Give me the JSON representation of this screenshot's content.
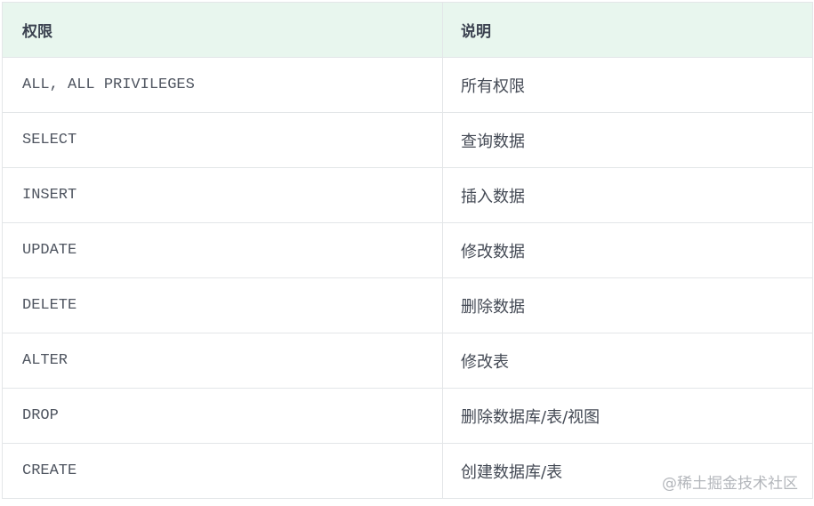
{
  "table": {
    "headers": [
      "权限",
      "说明"
    ],
    "rows": [
      {
        "privilege": "ALL, ALL PRIVILEGES",
        "description": "所有权限"
      },
      {
        "privilege": "SELECT",
        "description": "查询数据"
      },
      {
        "privilege": "INSERT",
        "description": "插入数据"
      },
      {
        "privilege": "UPDATE",
        "description": "修改数据"
      },
      {
        "privilege": "DELETE",
        "description": "删除数据"
      },
      {
        "privilege": "ALTER",
        "description": "修改表"
      },
      {
        "privilege": "DROP",
        "description": "删除数据库/表/视图"
      },
      {
        "privilege": "CREATE",
        "description": "创建数据库/表"
      }
    ]
  },
  "watermark": "@稀土掘金技术社区",
  "colors": {
    "header_bg": "#e8f6ee",
    "border": "#e3e6e8",
    "watermark": "#b3b6bb"
  }
}
